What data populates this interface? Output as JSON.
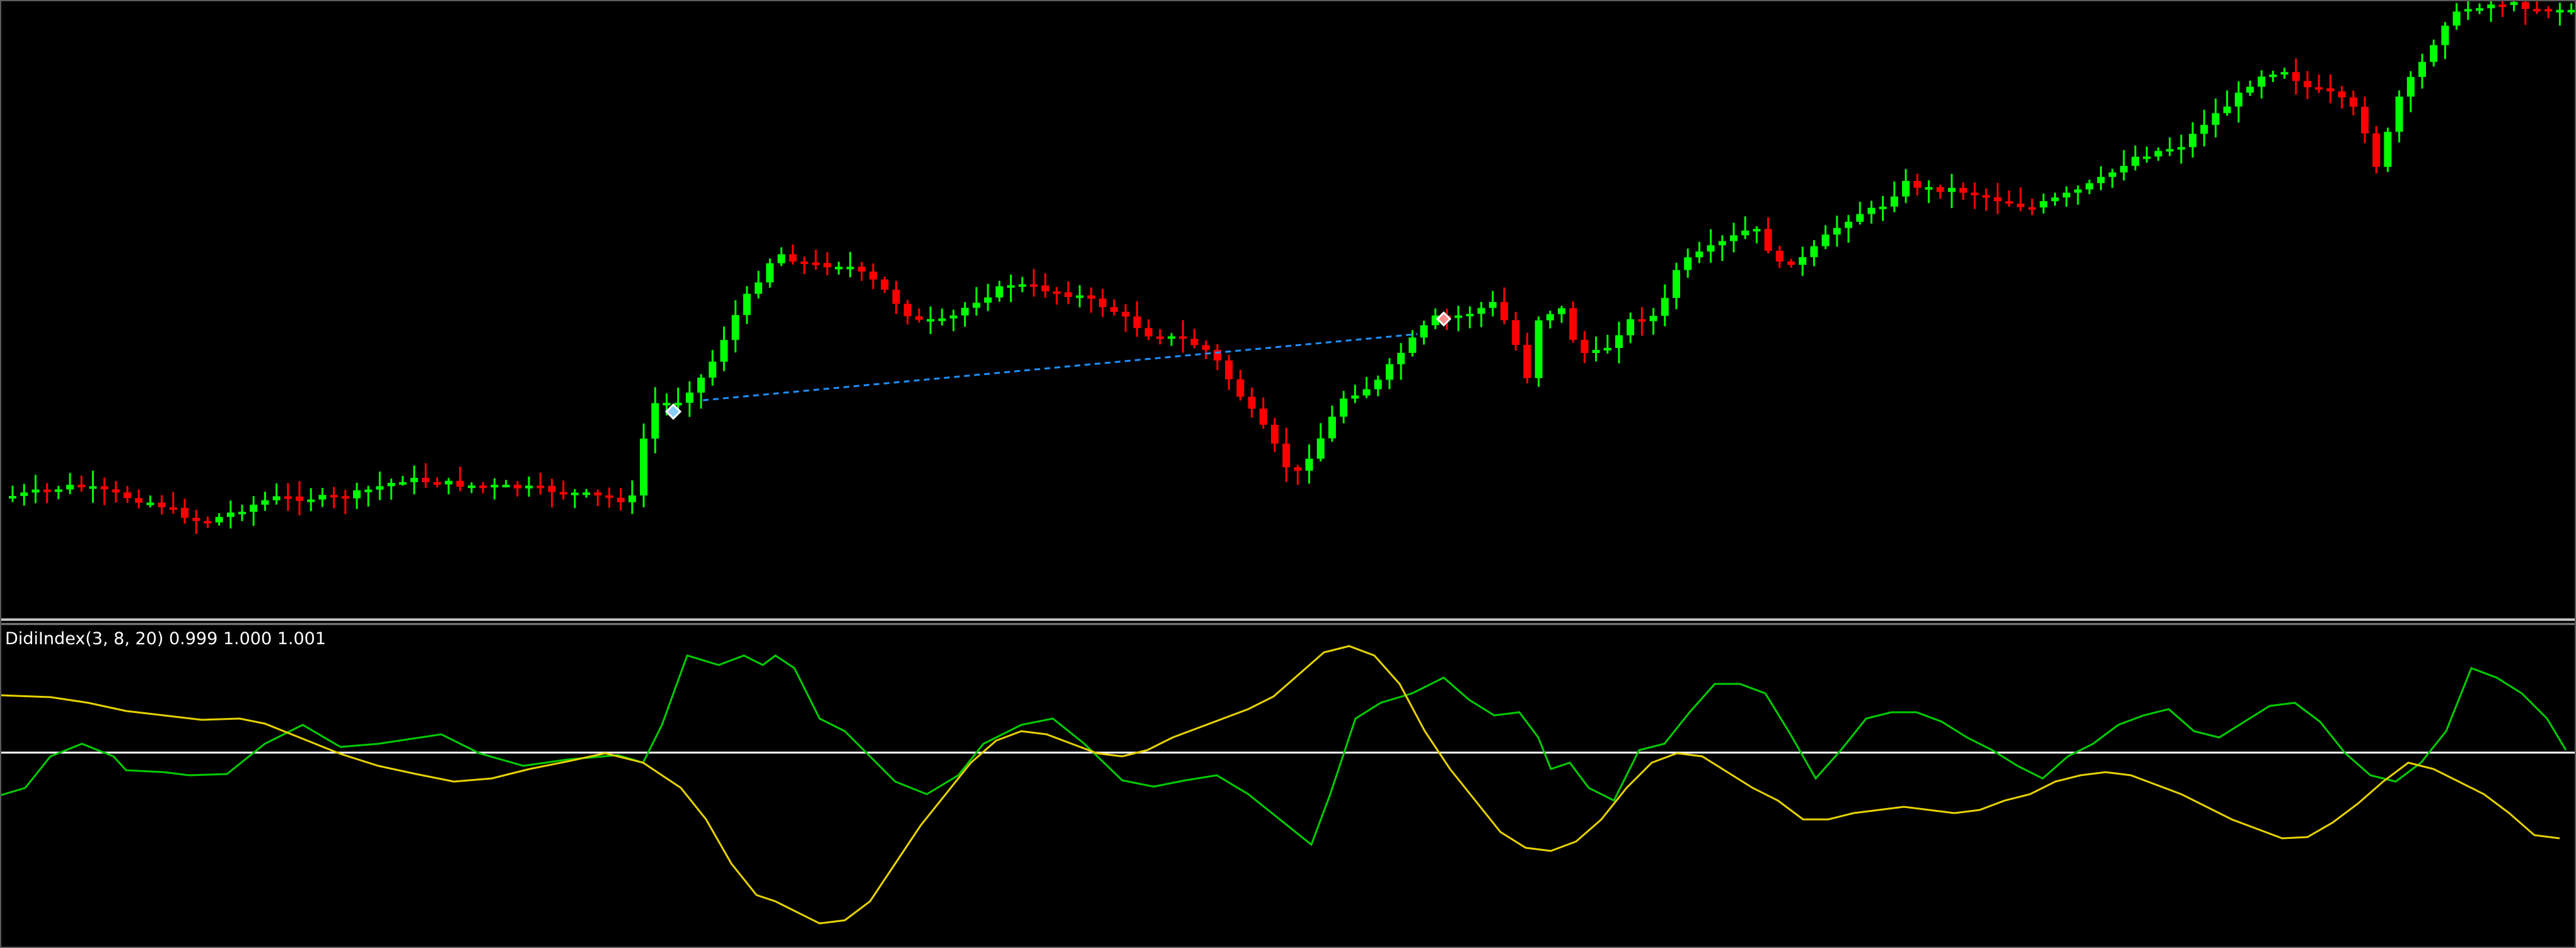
{
  "window": {
    "background": "#000000",
    "border_color": "#c0c0c0"
  },
  "main_chart": {
    "type": "candlestick",
    "bull_color": "#00ff00",
    "bear_color": "#ff0000",
    "trendline_color": "#1e90ff",
    "arrow_icons": [
      "buy-arrow-icon",
      "sell-arrow-icon"
    ]
  },
  "indicator": {
    "label": "DidiIndex(3, 8, 20) 0.999 1.000 1.001",
    "base_line_color": "#ffffff",
    "fast_color": "#00cc00",
    "slow_color": "#e6d200"
  }
}
